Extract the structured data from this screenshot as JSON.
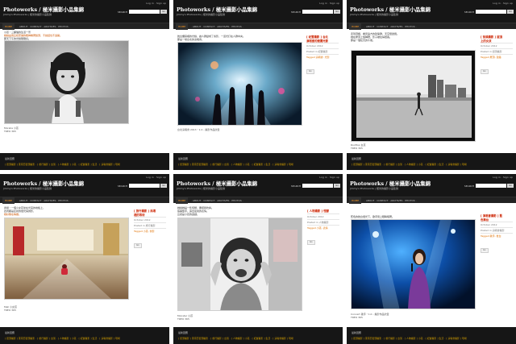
{
  "site": {
    "login": "Log in · Sign up",
    "brand": "Photoworks / 極米攝影小品集錦",
    "tagline": "Jimmy's Photoworks | 極米的攝影小品集錦",
    "search_label": "SEARCH",
    "search_button": "Go",
    "nav_home": "HOME",
    "nav_links": "· ABOUT · CONTACT · ARCHIVES · PHOTOS ·",
    "footer_link": "最新回應",
    "footer_links": "[ 街頭攝影 ] 東南亞街頭攝影 · [ 旅行攝影 ] 台灣 · [ 人物攝影 ] 小孩 · [ 紀實攝影 ] 生活 · [ 演唱會攝影 ] 現場"
  },
  "panels": [
    {
      "text_lines": [
        "小孩・三腳貓的生活一景",
        "她總是用這樣安靜的眼神看著鏡頭，不說話也不逃開。",
        "那天下午的光線剛剛好。"
      ],
      "caption_lines": [
        "Morelia 小孩",
        "TREO 365"
      ],
      "side": null
    },
    {
      "text_lines": [
        "舞台煙霧裡的光線，讓人群變成了剪影，一道光打在人群中央。",
        "那是一場台北的演唱會。"
      ],
      "caption_lines": [
        "台北演唱會 2013・1.0 - 攝影作品欣賞"
      ],
      "side": {
        "title": "[ 紀實攝影 ] 台北\n演唱會的煙霧光影",
        "rows": [
          "October 2012",
          "Posted in 紀實攝影",
          "Tagged 演唱會, 光影"
        ],
        "button": "Go"
      }
    },
    {
      "text_lines": [
        "走到頂樓，看見遠方的建築群，天空很遼闊。",
        "她在屋頂上旋轉著，影子被拉得很長。",
        "那是一個陰天的午後。"
      ],
      "caption_lines": [
        "Rooftop 女孩",
        "TREO 365"
      ],
      "side": {
        "title": "[ 街頭攝影 ] 屋頂\n上的女孩",
        "rows": [
          "October 2012",
          "Posted in 街頭攝影",
          "Tagged 屋頂, 建築"
        ],
        "button": "Go"
      }
    },
    {
      "text_lines": [
        "商場・一個小女孩坐在光亮的地板上，",
        "四周都是反射的燈光與倒影，",
        "她好像在等誰。"
      ],
      "caption_lines": [
        "Mall 小女孩",
        "TREO 365"
      ],
      "side": {
        "title": "[ 旅行攝影 ] 商場\n裡的等待",
        "rows": [
          "October 2012",
          "Posted in 旅行攝影",
          "Tagged 小孩, 倒影"
        ],
        "button": "Go"
      }
    },
    {
      "text_lines": [
        "她說她是一隻怪獸，要把我吃掉。",
        "張開雙手，露出最兇的表情。",
        "這就是小孩的遊戲。"
      ],
      "caption_lines": [
        "Monster 小孩",
        "TREO 365"
      ],
      "side": {
        "title": "[ 人物攝影 ] 怪獸",
        "rows": [
          "October 2012",
          "Posted in 人物攝影",
          "Tagged 小孩, 表情"
        ],
        "button": "Go"
      }
    },
    {
      "text_lines": [
        "藍色的舞台燈光下，歌手閉上眼睛唱著。"
      ],
      "caption_lines": [
        "Concert 歌手・1.0 - 攝影作品欣賞",
        "TREO 365"
      ],
      "side": {
        "title": "[ 演唱會攝影 ] 藍\n色舞台",
        "rows": [
          "October 2012",
          "Posted in 演唱會攝影",
          "Tagged 歌手, 舞台"
        ],
        "button": "Go"
      }
    }
  ]
}
